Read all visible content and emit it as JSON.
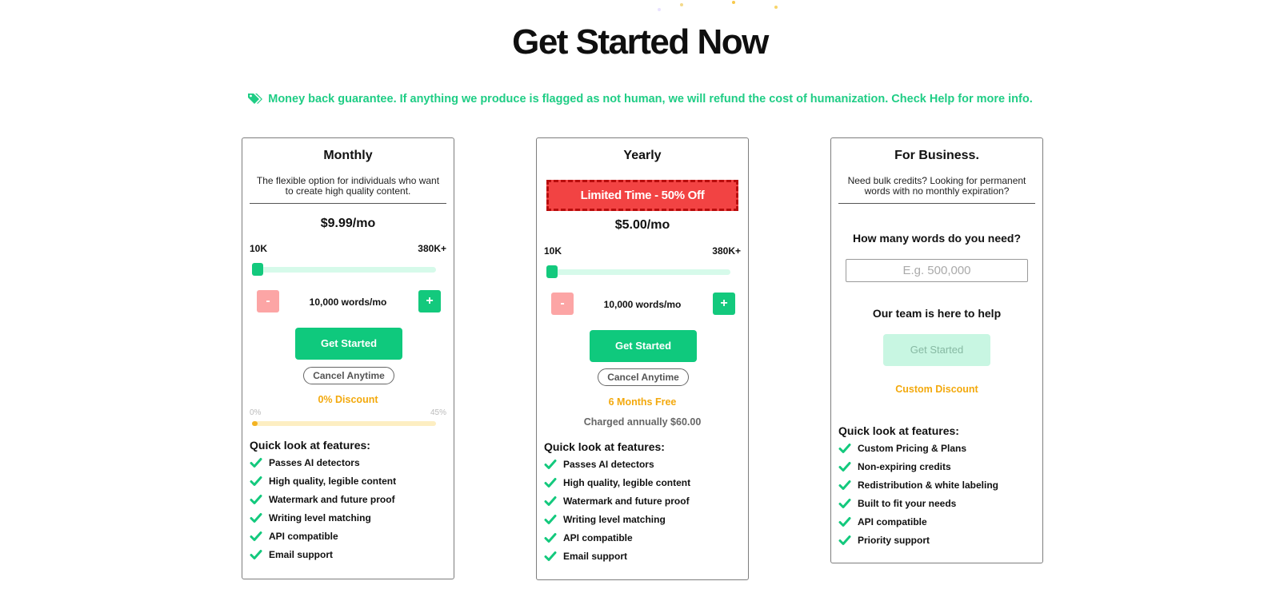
{
  "header": {
    "title": "Get Started Now",
    "guarantee": "Money back guarantee. If anything we produce is flagged as not human, we will refund the cost of humanization. Check Help for more info.",
    "guarantee_icon": "tag-icon"
  },
  "colors": {
    "brand_green": "#13c97d",
    "accent_orange": "#f3a90d",
    "promo_red": "#f24343",
    "minus_pink": "#fca5a5"
  },
  "monthly": {
    "title": "Monthly",
    "description": "The flexible option for individuals who want to create high quality content.",
    "price": "$9.99/mo",
    "slider_min_label": "10K",
    "slider_max_label": "380K+",
    "slider_value_fraction": 0,
    "minus_label": "-",
    "plus_label": "+",
    "words": "10,000 words/mo",
    "cta": "Get Started",
    "cancel": "Cancel Anytime",
    "discount": "0% Discount",
    "discount_min": "0%",
    "discount_max": "45%",
    "discount_progress_fraction": 0,
    "features_title": "Quick look at features:",
    "features": [
      "Passes AI detectors",
      "High quality, legible content",
      "Watermark and future proof",
      "Writing level matching",
      "API compatible",
      "Email support"
    ]
  },
  "yearly": {
    "title": "Yearly",
    "promo": "Limited Time - 50% Off",
    "price": "$5.00/mo",
    "slider_min_label": "10K",
    "slider_max_label": "380K+",
    "slider_value_fraction": 0,
    "minus_label": "-",
    "plus_label": "+",
    "words": "10,000 words/mo",
    "cta": "Get Started",
    "cancel": "Cancel Anytime",
    "bonus": "6 Months Free",
    "billing": "Charged annually $60.00",
    "features_title": "Quick look at features:",
    "features": [
      "Passes AI detectors",
      "High quality, legible content",
      "Watermark and future proof",
      "Writing level matching",
      "API compatible",
      "Email support"
    ]
  },
  "business": {
    "title": "For Business.",
    "description": "Need bulk credits? Looking for permanent words with no monthly expiration?",
    "question": "How many words do you need?",
    "input_placeholder": "E.g. 500,000",
    "input_value": "",
    "help": "Our team is here to help",
    "cta": "Get Started",
    "discount": "Custom Discount",
    "features_title": "Quick look at features:",
    "features": [
      "Custom Pricing & Plans",
      "Non-expiring credits",
      "Redistribution & white labeling",
      "Built to fit your needs",
      "API compatible",
      "Priority support"
    ]
  }
}
